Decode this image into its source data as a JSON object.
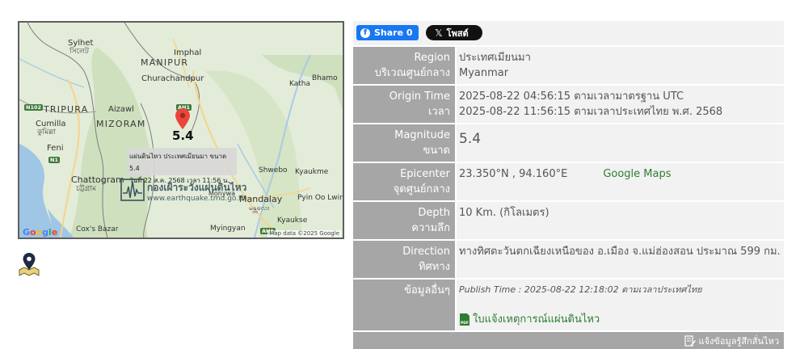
{
  "map": {
    "labels": {
      "sylhet": "Sylhet",
      "sylhet_local": "সিলেট",
      "manipur": "MANIPUR",
      "imphal": "Imphal",
      "churachandpur": "Churachandpur",
      "tripura": "TRIPURA",
      "aizawl": "Aizawl",
      "mizoram": "MIZORAM",
      "cumilla": "Cumilla",
      "cumilla_local": "কুমিল্লা",
      "feni": "Feni",
      "chattogram": "Chattogram",
      "chattogram_local": "চট্টগ্রাম",
      "katha": "Katha",
      "bhamo": "Bhamo",
      "shwebo": "Shwebo",
      "kyaukme": "Kyaukme",
      "mandalay": "Mandalay",
      "mandalay_local": "မန္တလေး",
      "monywa": "Monywa",
      "pyin_oo_lwin": "Pyin Oo Lwin",
      "kyaukse": "Kyaukse",
      "myingyan": "Myingyan",
      "coxs_bazar": "Cox's Bazar"
    },
    "shields": {
      "n102": "N102",
      "n1": "N1",
      "ah1_north": "AH1",
      "ah1_south": "AH1"
    },
    "magnitude_label": "5.4",
    "info_line1": "แผ่นดินไหว ประเทศเมียนมา ขนาด 5.4",
    "info_line2": "วันที่ 22 ส.ค. 2568 เวลา 11:56 น.",
    "watermark_title": "กองเฝ้าระวังแผ่นดินไหว",
    "watermark_url": "www.earthquake.tmd.go.th",
    "google_letters": [
      "G",
      "o",
      "o",
      "g",
      "l",
      "e"
    ],
    "credit": "Map data ©2025 Google"
  },
  "share": {
    "facebook_label": "Share 0",
    "x_label": "โพสต์"
  },
  "rows": {
    "region": {
      "label_en": "Region",
      "label_th": "บริเวณศูนย์กลาง",
      "value_th": "ประเทศเมียนมา",
      "value_en": "Myanmar"
    },
    "origin_time": {
      "label_en": "Origin Time",
      "label_th": "เวลา",
      "value_utc": "2025-08-22 04:56:15 ตามเวลามาตรฐาน UTC",
      "value_th": "2025-08-22 11:56:15 ตามเวลาประเทศไทย พ.ศ. 2568"
    },
    "magnitude": {
      "label_en": "Magnitude",
      "label_th": "ขนาด",
      "value": "5.4"
    },
    "epicenter": {
      "label_en": "Epicenter",
      "label_th": "จุดศูนย์กลาง",
      "value": "23.350°N , 94.160°E",
      "maps_link": "Google Maps"
    },
    "depth": {
      "label_en": "Depth",
      "label_th": "ความลึก",
      "value": "10 Km. (กิโลเมตร)"
    },
    "direction": {
      "label_en": "Direction",
      "label_th": "ทิศทาง",
      "value": "ทางทิศตะวันตกเฉียงเหนือของ อ.เมือง จ.แม่ฮ่องสอน ประมาณ 599 กม."
    },
    "other": {
      "label_th": "ข้อมูลอื่นๆ",
      "publish_time": "Publish Time : 2025-08-22 12:18:02 ตามเวลาประเทศไทย",
      "pdf_link": "ใบแจ้งเหตุการณ์แผ่นดินไหว",
      "pdf_icon_text": "PDF"
    }
  },
  "report": {
    "label": "แจ้งข้อมูลรู้สึกสั่นไหว"
  },
  "colors": {
    "accent_green": "#2e7d32",
    "label_gray": "#a6a6a6",
    "value_bg": "#f2f2f2",
    "facebook": "#1877f2",
    "pin_red": "#e8453c"
  }
}
